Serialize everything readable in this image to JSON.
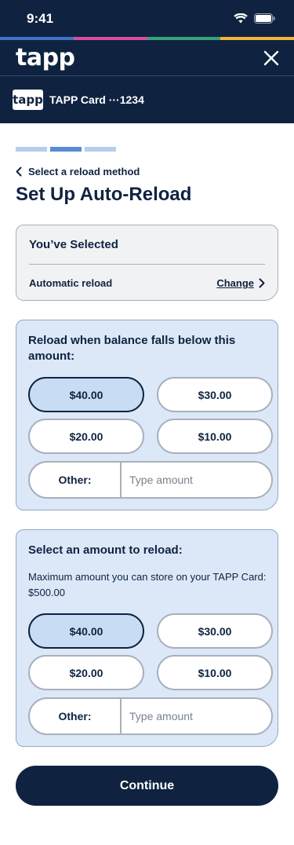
{
  "status_bar": {
    "time": "9:41"
  },
  "colors": {
    "navy": "#0f2340",
    "panel_bg": "#dce8f8",
    "selected_pill": "#c8dcf4",
    "accent_stripe": [
      "#3f76c8",
      "#d94ea2",
      "#38a378",
      "#f2b53a"
    ]
  },
  "header": {
    "logo": "tapp",
    "close_icon": "close-icon"
  },
  "card": {
    "chip": "tapp",
    "name": "TAPP Card ···1234"
  },
  "progress": {
    "steps": 3,
    "current": 2
  },
  "nav": {
    "back_label": "Select a reload method"
  },
  "page": {
    "title": "Set Up Auto-Reload"
  },
  "selection": {
    "heading": "You’ve Selected",
    "method": "Automatic reload",
    "change_label": "Change"
  },
  "threshold": {
    "heading": "Reload when balance falls below this amount:",
    "options": [
      "$40.00",
      "$30.00",
      "$20.00",
      "$10.00"
    ],
    "selected": "$40.00",
    "other_label": "Other:",
    "other_placeholder": "Type amount"
  },
  "reload_amount": {
    "heading": "Select an amount to reload:",
    "note": "Maximum amount you can store on your TAPP Card: $500.00",
    "options": [
      "$40.00",
      "$30.00",
      "$20.00",
      "$10.00"
    ],
    "selected": "$40.00",
    "other_label": "Other:",
    "other_placeholder": "Type amount"
  },
  "footer": {
    "continue_label": "Continue"
  }
}
